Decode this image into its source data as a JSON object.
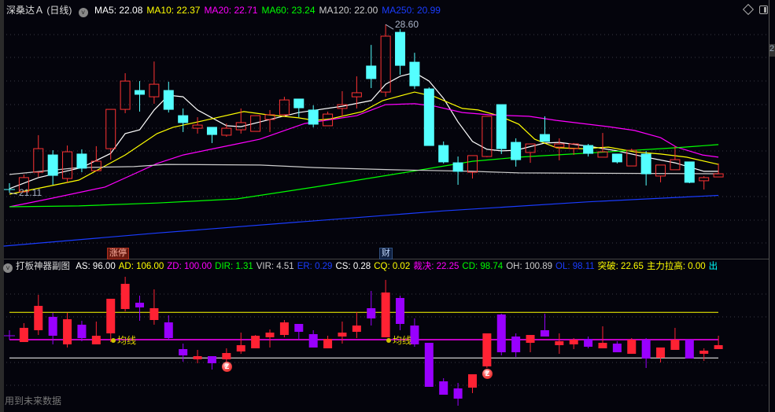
{
  "header": {
    "title": "深桑达Ａ (日线)",
    "ma_legend": [
      {
        "label": "MA5: 22.08",
        "color": "#ffffff"
      },
      {
        "label": "MA10: 22.37",
        "color": "#ffff00"
      },
      {
        "label": "MA20: 22.71",
        "color": "#ff00ff"
      },
      {
        "label": "MA60: 23.24",
        "color": "#00ff00"
      },
      {
        "label": "MA120: 22.00",
        "color": "#cccccc"
      },
      {
        "label": "MA250: 20.99",
        "color": "#1a3cff"
      }
    ],
    "icons": [
      "diamond-icon",
      "panel-toggle-icon"
    ]
  },
  "axis_fragment": "2",
  "main_chart": {
    "high_label": "28.60",
    "low_label": "21.11",
    "tags": {
      "limit_up": "涨停",
      "finance": "财"
    },
    "ylim": [
      18.31,
      29.06
    ],
    "up_color": "#ff3333",
    "down_color": "#54ffff",
    "candles": [
      [
        21.25,
        21.53,
        21.11,
        21.25
      ],
      [
        21.15,
        21.92,
        21.11,
        21.78
      ],
      [
        22.02,
        23.67,
        21.81,
        23.07
      ],
      [
        22.79,
        23.0,
        21.46,
        21.88
      ],
      [
        21.74,
        23.21,
        21.57,
        22.93
      ],
      [
        22.83,
        23.04,
        22.02,
        22.2
      ],
      [
        22.09,
        23.18,
        22.09,
        22.51
      ],
      [
        23.07,
        24.82,
        22.58,
        24.82
      ],
      [
        24.82,
        26.43,
        24.65,
        26.08
      ],
      [
        25.66,
        26.08,
        24.72,
        25.49
      ],
      [
        25.38,
        26.95,
        25.07,
        25.94
      ],
      [
        25.66,
        26.05,
        24.68,
        24.82
      ],
      [
        24.54,
        24.86,
        23.81,
        24.23
      ],
      [
        23.98,
        24.47,
        23.74,
        24.12
      ],
      [
        24.02,
        24.02,
        23.32,
        23.7
      ],
      [
        23.67,
        24.19,
        23.6,
        23.98
      ],
      [
        23.91,
        24.86,
        23.74,
        24.23
      ],
      [
        23.84,
        24.54,
        23.84,
        24.54
      ],
      [
        24.37,
        24.79,
        23.81,
        24.58
      ],
      [
        24.58,
        25.38,
        24.51,
        25.24
      ],
      [
        25.28,
        25.28,
        24.47,
        24.89
      ],
      [
        24.79,
        25.0,
        24.02,
        24.16
      ],
      [
        24.09,
        24.72,
        24.09,
        24.61
      ],
      [
        24.86,
        25.63,
        24.51,
        25.03
      ],
      [
        25.38,
        26.29,
        24.86,
        25.56
      ],
      [
        26.75,
        27.69,
        25.77,
        26.19
      ],
      [
        25.59,
        28.6,
        25.38,
        28.08
      ],
      [
        28.25,
        28.39,
        26.36,
        26.78
      ],
      [
        26.92,
        27.34,
        25.73,
        25.87
      ],
      [
        25.73,
        25.8,
        23.21,
        23.21
      ],
      [
        23.21,
        23.39,
        22.41,
        22.48
      ],
      [
        22.44,
        22.72,
        21.46,
        22.06
      ],
      [
        22.02,
        22.76,
        21.74,
        22.76
      ],
      [
        22.72,
        24.51,
        22.69,
        24.51
      ],
      [
        25.03,
        25.03,
        22.83,
        23.07
      ],
      [
        23.35,
        23.53,
        22.27,
        22.58
      ],
      [
        22.9,
        23.28,
        22.44,
        23.28
      ],
      [
        23.7,
        24.51,
        23.39,
        23.39
      ],
      [
        23.14,
        23.53,
        22.55,
        23.28
      ],
      [
        23.07,
        23.32,
        22.79,
        23.28
      ],
      [
        23.21,
        23.28,
        22.72,
        22.86
      ],
      [
        22.69,
        23.77,
        22.69,
        22.93
      ],
      [
        22.83,
        22.83,
        22.41,
        22.48
      ],
      [
        22.3,
        23.07,
        22.3,
        23.0
      ],
      [
        22.83,
        22.97,
        21.43,
        21.95
      ],
      [
        21.85,
        22.34,
        21.57,
        22.34
      ],
      [
        22.13,
        23.18,
        22.13,
        22.58
      ],
      [
        22.48,
        22.48,
        21.53,
        21.57
      ],
      [
        21.64,
        21.85,
        21.25,
        21.78
      ],
      [
        21.81,
        22.41,
        21.81,
        21.95
      ]
    ],
    "ma_series": [
      {
        "name": "MA5",
        "color": "#ffffff",
        "points": [
          [
            0,
            21.29
          ],
          [
            2,
            21.78
          ],
          [
            5,
            22.23
          ],
          [
            7,
            22.86
          ],
          [
            8,
            23.74
          ],
          [
            9,
            23.91
          ],
          [
            10,
            24.79
          ],
          [
            11,
            25.45
          ],
          [
            12,
            25.38
          ],
          [
            13,
            24.79
          ],
          [
            15,
            24.09
          ],
          [
            16,
            24.05
          ],
          [
            18,
            24.37
          ],
          [
            20,
            24.68
          ],
          [
            23,
            24.96
          ],
          [
            25,
            25.21
          ],
          [
            26,
            25.94
          ],
          [
            27,
            26.29
          ],
          [
            28,
            26.46
          ],
          [
            29,
            26.08
          ],
          [
            30,
            25.31
          ],
          [
            31,
            24.26
          ],
          [
            32,
            23.39
          ],
          [
            33,
            23.04
          ],
          [
            34,
            22.97
          ],
          [
            35,
            23.0
          ],
          [
            37,
            23.32
          ],
          [
            38,
            23.35
          ],
          [
            40,
            23.18
          ],
          [
            42,
            22.97
          ],
          [
            44,
            22.69
          ],
          [
            46,
            22.44
          ],
          [
            48,
            22.06
          ],
          [
            49,
            22.06
          ]
        ]
      },
      {
        "name": "MA10",
        "color": "#ffff00",
        "points": [
          [
            0,
            21.04
          ],
          [
            4.8,
            21.67
          ],
          [
            6.4,
            22.23
          ],
          [
            8,
            22.79
          ],
          [
            10.2,
            23.74
          ],
          [
            11.3,
            24.02
          ],
          [
            13.5,
            24.33
          ],
          [
            16.2,
            24.72
          ],
          [
            17.8,
            24.58
          ],
          [
            20,
            24.44
          ],
          [
            21.1,
            24.33
          ],
          [
            22.2,
            24.4
          ],
          [
            24.4,
            24.72
          ],
          [
            25.8,
            25.21
          ],
          [
            28,
            25.59
          ],
          [
            29.4,
            25.38
          ],
          [
            31.3,
            24.86
          ],
          [
            32.4,
            24.79
          ],
          [
            33.8,
            24.54
          ],
          [
            35.2,
            24.16
          ],
          [
            36.3,
            23.49
          ],
          [
            37.8,
            23.11
          ],
          [
            39.6,
            23.07
          ],
          [
            41.4,
            23.14
          ],
          [
            43.2,
            22.93
          ],
          [
            45,
            22.83
          ],
          [
            46.8,
            22.69
          ],
          [
            49,
            22.37
          ]
        ]
      },
      {
        "name": "MA20",
        "color": "#ff00ff",
        "points": [
          [
            0,
            20.48
          ],
          [
            1.1,
            20.62
          ],
          [
            3,
            20.87
          ],
          [
            6.6,
            21.36
          ],
          [
            8.4,
            21.88
          ],
          [
            10.2,
            22.41
          ],
          [
            12,
            22.79
          ],
          [
            13.9,
            23.04
          ],
          [
            15.7,
            23.28
          ],
          [
            17.3,
            23.49
          ],
          [
            20.4,
            24.19
          ],
          [
            24,
            24.54
          ],
          [
            26,
            25.03
          ],
          [
            28,
            25.07
          ],
          [
            29.4,
            24.96
          ],
          [
            31.3,
            24.68
          ],
          [
            33.1,
            24.58
          ],
          [
            34.7,
            24.54
          ],
          [
            35.9,
            24.51
          ],
          [
            37.8,
            24.33
          ],
          [
            39.6,
            24.19
          ],
          [
            41.4,
            24.05
          ],
          [
            43.2,
            23.88
          ],
          [
            45,
            23.56
          ],
          [
            46.1,
            23.14
          ],
          [
            47.9,
            22.79
          ],
          [
            49,
            22.69
          ]
        ]
      },
      {
        "name": "MA60",
        "color": "#00ff00",
        "points": [
          [
            0,
            20.48
          ],
          [
            4.8,
            20.52
          ],
          [
            10.2,
            20.65
          ],
          [
            15.7,
            20.83
          ],
          [
            21.1,
            21.36
          ],
          [
            26.5,
            21.92
          ],
          [
            32,
            22.51
          ],
          [
            35.2,
            22.69
          ],
          [
            40.7,
            22.9
          ],
          [
            46.1,
            23.11
          ],
          [
            49,
            23.25
          ]
        ]
      },
      {
        "name": "MA120",
        "color": "#cccccc",
        "points": [
          [
            0,
            21.92
          ],
          [
            4.8,
            22.23
          ],
          [
            8.6,
            22.27
          ],
          [
            10.8,
            22.37
          ],
          [
            17.3,
            22.34
          ],
          [
            21.1,
            22.23
          ],
          [
            26.5,
            22.13
          ],
          [
            32,
            22.06
          ],
          [
            35.2,
            21.99
          ],
          [
            49,
            21.95
          ]
        ]
      },
      {
        "name": "MA250",
        "color": "#1a3cff",
        "points": [
          [
            -0.4,
            18.73
          ],
          [
            10,
            19.3
          ],
          [
            20,
            19.8
          ],
          [
            30,
            20.3
          ],
          [
            40,
            20.7
          ],
          [
            49,
            20.99
          ]
        ]
      }
    ]
  },
  "sub_chart": {
    "title": "打板神器副图",
    "legend": [
      {
        "label": "AS: 96.00",
        "color": "#ffffff"
      },
      {
        "label": "AD: 106.00",
        "color": "#ffff00"
      },
      {
        "label": "ZD: 100.00",
        "color": "#ff00ff"
      },
      {
        "label": "DIR: 1.31",
        "color": "#00ff00"
      },
      {
        "label": "VIR: 4.51",
        "color": "#cccccc"
      },
      {
        "label": "ER: 0.29",
        "color": "#1a3cff"
      },
      {
        "label": "CS: 0.28",
        "color": "#ffffff"
      },
      {
        "label": "CQ: 0.02",
        "color": "#ffff00"
      },
      {
        "label": "裁决: 22.25",
        "color": "#ff00ff"
      },
      {
        "label": "CD: 98.74",
        "color": "#00ff00"
      },
      {
        "label": "OH: 100.89",
        "color": "#cccccc"
      },
      {
        "label": "OL: 98.11",
        "color": "#1a3cff"
      },
      {
        "label": "突破: 22.65",
        "color": "#ffff00"
      },
      {
        "label": "主力拉高: 0.00",
        "color": "#ffff00"
      },
      {
        "label": "出",
        "color": "#00ffff"
      }
    ],
    "levels": {
      "AS": 96,
      "AD": 106,
      "ZD": 100
    },
    "ma_tag": "均线",
    "badge_glyph": "Z",
    "future_data_note": "用到未来数据",
    "up_color": "#ff2233",
    "down_color": "#9900ff",
    "bars": [
      [
        100.86,
        102.07,
        100,
        100.86
      ],
      [
        99.48,
        103.62,
        99.48,
        102.59
      ],
      [
        102.07,
        109.83,
        101.03,
        107.41
      ],
      [
        105,
        105.86,
        98.97,
        100.86
      ],
      [
        98.97,
        105.86,
        98.28,
        104.48
      ],
      [
        103.28,
        104.14,
        99.66,
        100.34
      ],
      [
        98.97,
        103.97,
        98.97,
        100.86
      ],
      [
        101.38,
        108.97,
        99.48,
        108.97
      ],
      [
        106.72,
        113.79,
        106.21,
        112.24
      ],
      [
        108.1,
        109.66,
        104.14,
        107.07
      ],
      [
        104.31,
        111.03,
        103.28,
        106.9
      ],
      [
        103.79,
        105.34,
        99.83,
        100.34
      ],
      [
        97.93,
        99.14,
        95.17,
        96.55
      ],
      [
        95.69,
        97.76,
        94.83,
        96.38
      ],
      [
        96.38,
        96.38,
        93.45,
        94.83
      ],
      [
        95.69,
        98.1,
        95.17,
        97.07
      ],
      [
        97.41,
        101.55,
        96.9,
        98.79
      ],
      [
        98.1,
        101.03,
        98.1,
        100.86
      ],
      [
        100.52,
        102.24,
        98.28,
        101.55
      ],
      [
        101.03,
        104.31,
        100.52,
        103.79
      ],
      [
        103.45,
        103.45,
        100,
        101.72
      ],
      [
        101.21,
        102.07,
        98.28,
        98.28
      ],
      [
        98.1,
        100.86,
        98.1,
        100.17
      ],
      [
        100.69,
        103.97,
        99.14,
        101.55
      ],
      [
        101.72,
        106.03,
        100.34,
        103.1
      ],
      [
        106.9,
        110.69,
        103.1,
        104.66
      ],
      [
        100.52,
        113.1,
        100.52,
        110.34
      ],
      [
        109.14,
        109.66,
        102.07,
        103.45
      ],
      [
        103.1,
        104.66,
        98.45,
        98.97
      ],
      [
        99.31,
        99.31,
        89.66,
        89.66
      ],
      [
        90.86,
        91.55,
        87.93,
        87.93
      ],
      [
        89.31,
        90.52,
        85.52,
        87.07
      ],
      [
        89.48,
        92.41,
        88.28,
        92.41
      ],
      [
        94.14,
        101.38,
        93.79,
        101.38
      ],
      [
        105.52,
        105.69,
        96.55,
        97.24
      ],
      [
        100.69,
        101.38,
        96.21,
        97.24
      ],
      [
        99.31,
        101.03,
        97.24,
        101.03
      ],
      [
        102.07,
        105.69,
        100.69,
        100.69
      ],
      [
        98.79,
        101.38,
        96.9,
        99.66
      ],
      [
        98.97,
        100.34,
        97.93,
        100
      ],
      [
        100.17,
        100.69,
        98.1,
        98.45
      ],
      [
        98.1,
        102.93,
        98.1,
        99.31
      ],
      [
        99.14,
        99.66,
        97.24,
        97.24
      ],
      [
        96.9,
        100.34,
        96.9,
        100
      ],
      [
        100,
        100.34,
        93.79,
        95.86
      ],
      [
        96.03,
        98.28,
        95,
        98.28
      ],
      [
        97.76,
        102.59,
        97.76,
        100
      ],
      [
        100,
        100,
        95.86,
        95.86
      ],
      [
        96.9,
        98.1,
        95.34,
        97.59
      ],
      [
        97.93,
        100.86,
        97.93,
        98.79
      ]
    ]
  }
}
